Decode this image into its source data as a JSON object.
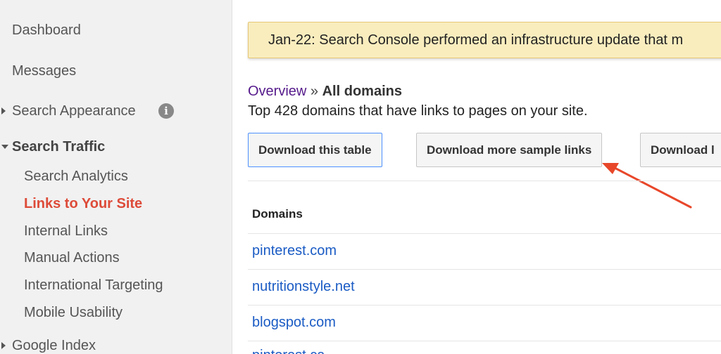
{
  "sidebar": {
    "items": [
      {
        "label": "Dashboard"
      },
      {
        "label": "Messages"
      },
      {
        "label": "Search Appearance"
      },
      {
        "label": "Search Traffic"
      },
      {
        "label": "Search Analytics"
      },
      {
        "label": "Links to Your Site"
      },
      {
        "label": "Internal Links"
      },
      {
        "label": "Manual Actions"
      },
      {
        "label": "International Targeting"
      },
      {
        "label": "Mobile Usability"
      },
      {
        "label": "Google Index"
      }
    ],
    "info_glyph": "i"
  },
  "banner": {
    "text": "Jan-22: Search Console performed an infrastructure update that m"
  },
  "breadcrumb": {
    "link": "Overview",
    "separator": "»",
    "current": "All domains"
  },
  "subtitle": "Top 428 domains that have links to pages on your site.",
  "buttons": {
    "download_table": "Download this table",
    "download_sample": "Download more sample links",
    "download_latest": "Download l"
  },
  "table": {
    "header": "Domains",
    "rows": [
      "pinterest.com",
      "nutritionstyle.net",
      "blogspot.com",
      "pinterest.ca"
    ]
  },
  "colors": {
    "active_nav": "#dd4b39",
    "link": "#1a5bc4",
    "visited_link": "#551a8b",
    "banner_bg": "#f9edbe",
    "arrow": "#e8472a"
  }
}
